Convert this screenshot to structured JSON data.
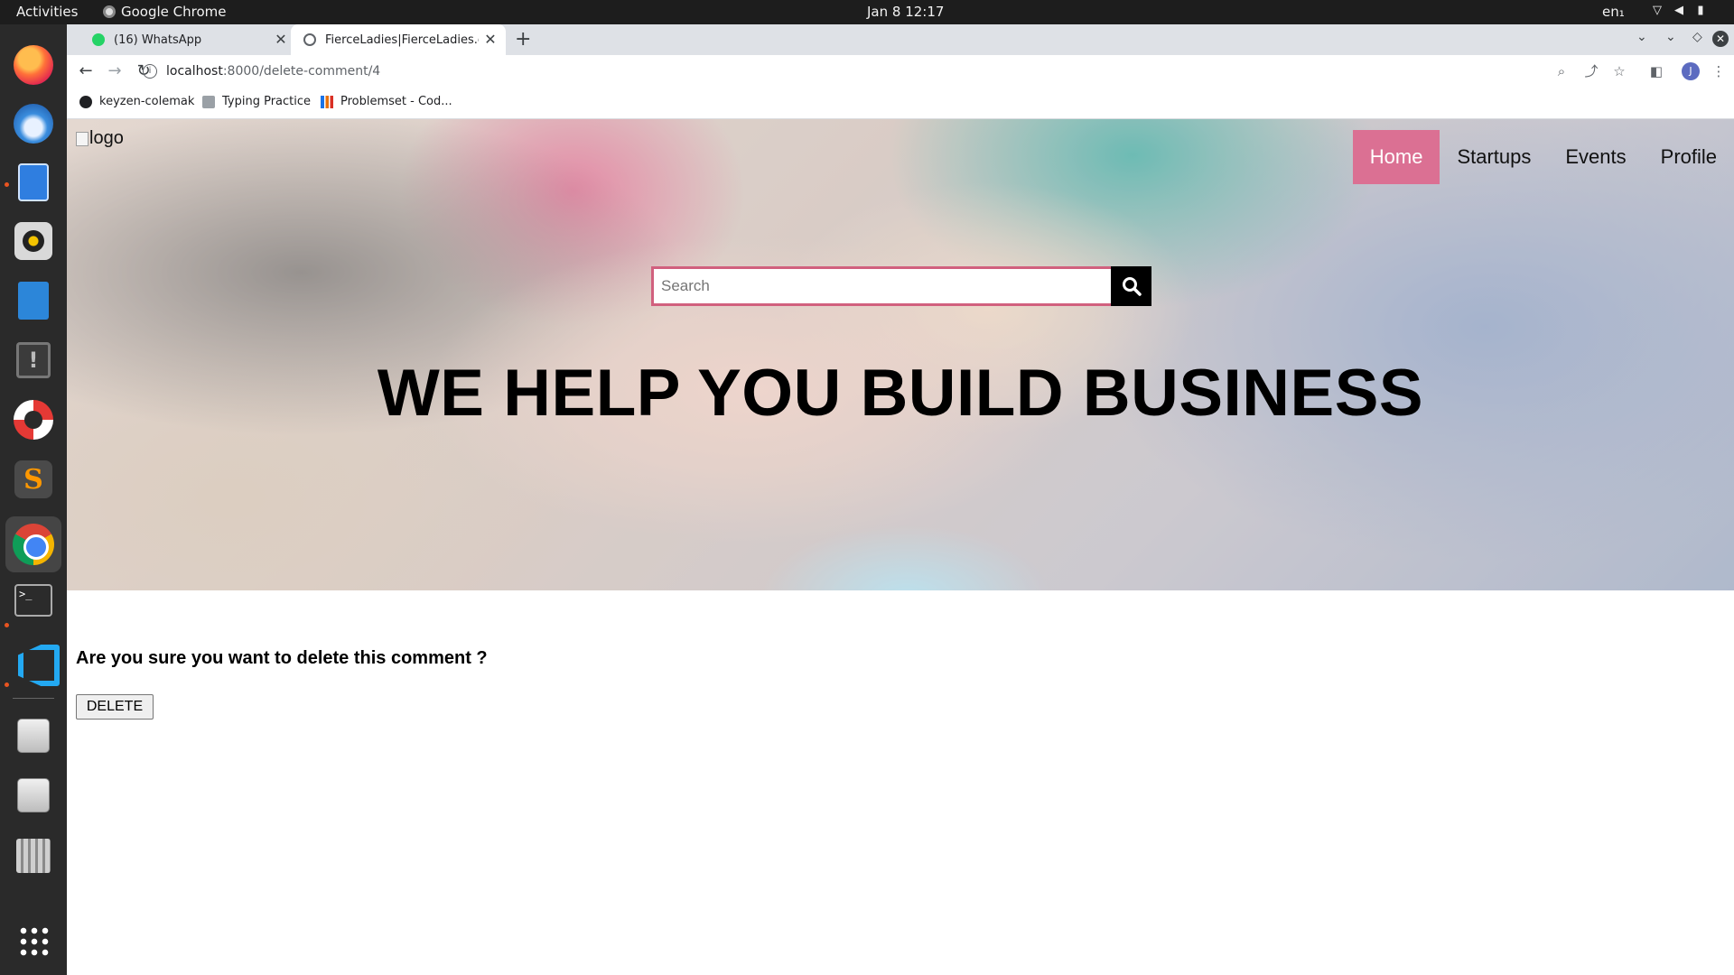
{
  "system": {
    "activities": "Activities",
    "app_name": "Google Chrome",
    "clock": "Jan 8  12:17",
    "lang": "en₁"
  },
  "browser": {
    "tabs": [
      {
        "title": "(16) WhatsApp",
        "active": false
      },
      {
        "title": "FierceLadies|FierceLadies.com",
        "active": true
      }
    ],
    "url_host": "localhost",
    "url_path": ":8000/delete-comment/4",
    "bookmarks": [
      "keyzen-colemak",
      "Typing Practice",
      "Problemset - Cod..."
    ],
    "profile_initial": "J"
  },
  "site": {
    "logo_alt": "logo",
    "nav": [
      "Home",
      "Startups",
      "Events",
      "Profile"
    ],
    "search_placeholder": "Search",
    "headline": "WE HELP YOU BUILD BUSINESS",
    "confirm_text": "Are you sure you want to delete this comment ?",
    "delete_label": "DELETE",
    "accent_color": "#db7093"
  }
}
